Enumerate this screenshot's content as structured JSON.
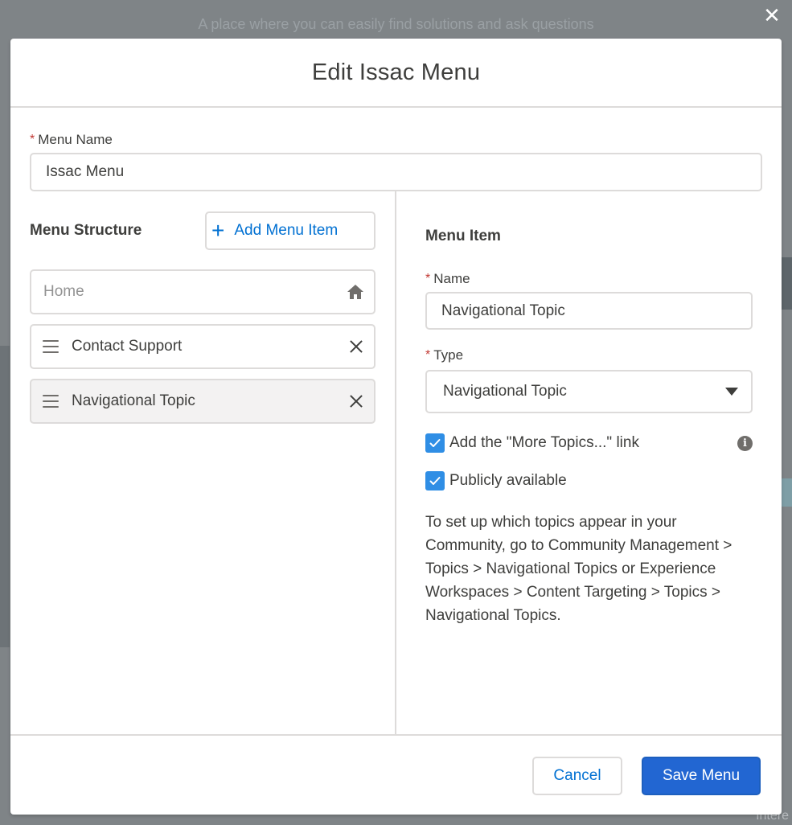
{
  "backdrop": {
    "tagline": "A place where you can easily find solutions and ask questions",
    "close_icon": "close-icon",
    "footer_fragment": "Intere"
  },
  "modal": {
    "title": "Edit Issac Menu"
  },
  "menu_name": {
    "label": "Menu Name",
    "required_marker": "*",
    "value": "Issac Menu"
  },
  "menu_structure": {
    "title": "Menu Structure",
    "add_button_icon": "+",
    "add_button_label": "Add Menu Item",
    "items": [
      {
        "label": "Home",
        "icon": "home-icon"
      },
      {
        "label": "Contact Support",
        "icon": "drag-handle-icon",
        "action_icon": "remove-icon"
      },
      {
        "label": "Navigational Topic",
        "icon": "drag-handle-icon",
        "action_icon": "remove-icon",
        "selected": true
      }
    ]
  },
  "menu_item": {
    "title": "Menu Item",
    "name_label": "Name",
    "name_value": "Navigational Topic",
    "type_label": "Type",
    "type_value": "Navigational Topic",
    "more_topics_label": "Add the \"More Topics...\" link",
    "more_topics_checked": true,
    "public_label": "Publicly available",
    "public_checked": true,
    "help_text": "To set up which topics appear in your Community, go to Community Management > Topics > Navigational Topics or Experience Workspaces > Content Targeting > Topics > Navigational Topics."
  },
  "footer": {
    "cancel_label": "Cancel",
    "save_label": "Save Menu"
  },
  "colors": {
    "accent": "#0070d2",
    "primary_button": "#2266d2",
    "checkbox": "#2f8ee5",
    "required": "#c23934",
    "border": "#dddbda"
  }
}
